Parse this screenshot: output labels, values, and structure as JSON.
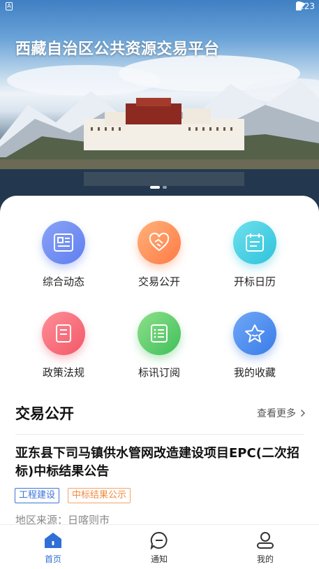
{
  "status_bar": {
    "time": "9:23"
  },
  "hero": {
    "title": "西藏自治区公共资源交易平台"
  },
  "menu": [
    {
      "label": "综合动态",
      "icon": "news-icon",
      "color_from": "#8aa3f5",
      "color_to": "#5f7ff0"
    },
    {
      "label": "交易公开",
      "icon": "handshake-icon",
      "color_from": "#ffb27a",
      "color_to": "#ff7a45"
    },
    {
      "label": "开标日历",
      "icon": "calendar-icon",
      "color_from": "#6fe0ec",
      "color_to": "#2ec3dc"
    },
    {
      "label": "政策法规",
      "icon": "book-icon",
      "color_from": "#ff8e98",
      "color_to": "#f25868"
    },
    {
      "label": "标讯订阅",
      "icon": "list-icon",
      "color_from": "#8ee08a",
      "color_to": "#3fbf5a"
    },
    {
      "label": "我的收藏",
      "icon": "star-icon",
      "color_from": "#6fa8f7",
      "color_to": "#3a7ce8"
    }
  ],
  "section": {
    "title": "交易公开",
    "more": "查看更多"
  },
  "news": {
    "title": "亚东县下司马镇供水管网改造建设项目EPC(二次招标)中标结果公告",
    "tags": [
      "工程建设",
      "中标结果公示"
    ],
    "source": "地区来源：日喀则市"
  },
  "nav": [
    {
      "label": "首页",
      "icon": "home-icon",
      "active": true
    },
    {
      "label": "通知",
      "icon": "message-icon",
      "active": false
    },
    {
      "label": "我的",
      "icon": "user-icon",
      "active": false
    }
  ],
  "colors": {
    "primary": "#2f6fd6",
    "tag_blue": "#3b73d9",
    "tag_orange": "#f08a3c"
  }
}
